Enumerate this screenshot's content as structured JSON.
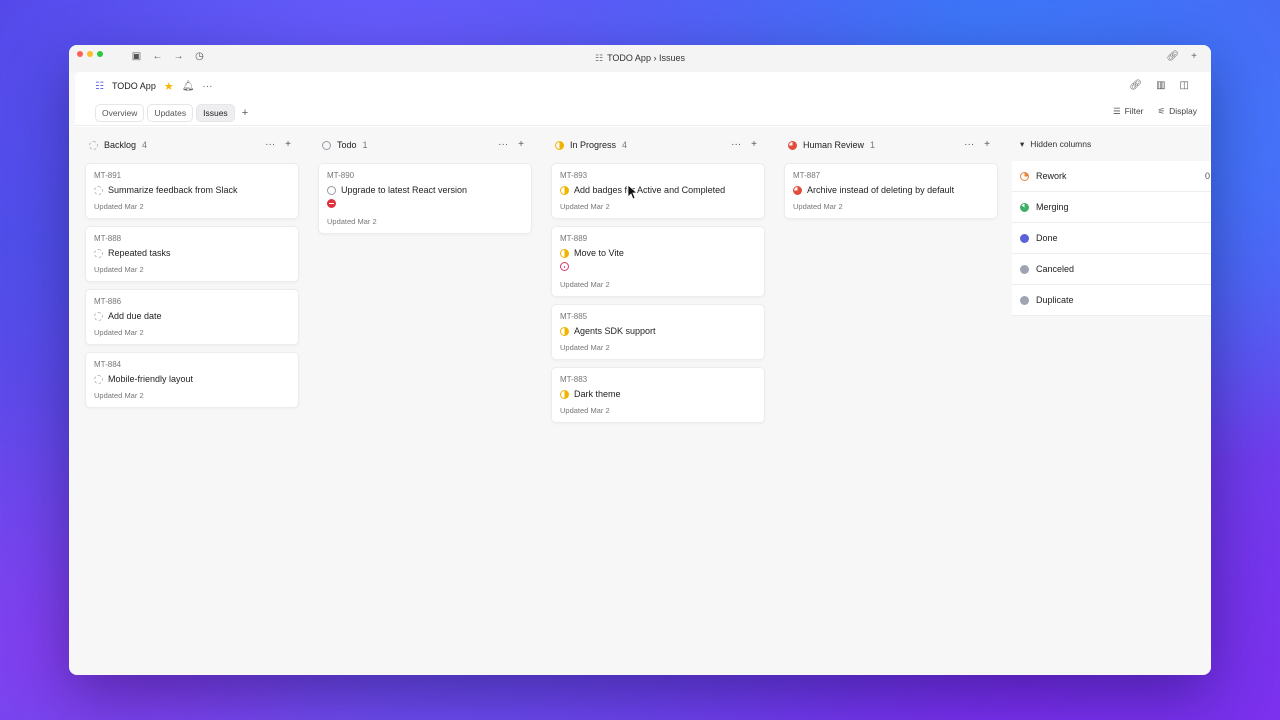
{
  "window": {
    "title": "TODO App › Issues"
  },
  "app": {
    "name": "TODO App"
  },
  "tabs": [
    {
      "label": "Overview"
    },
    {
      "label": "Updates"
    },
    {
      "label": "Issues"
    }
  ],
  "toolbar": {
    "filter_label": "Filter",
    "display_label": "Display"
  },
  "columns": [
    {
      "name": "Backlog",
      "count": "4",
      "cards": [
        {
          "id": "MT-891",
          "title": "Summarize feedback from Slack",
          "updated": "Updated Mar 2"
        },
        {
          "id": "MT-888",
          "title": "Repeated tasks",
          "updated": "Updated Mar 2"
        },
        {
          "id": "MT-886",
          "title": "Add due date",
          "updated": "Updated Mar 2"
        },
        {
          "id": "MT-884",
          "title": "Mobile-friendly layout",
          "updated": "Updated Mar 2"
        }
      ]
    },
    {
      "name": "Todo",
      "count": "1",
      "cards": [
        {
          "id": "MT-890",
          "title": "Upgrade to latest React version",
          "updated": "Updated Mar 2"
        }
      ]
    },
    {
      "name": "In Progress",
      "count": "4",
      "cards": [
        {
          "id": "MT-893",
          "title": "Add badges for Active and Completed",
          "updated": "Updated Mar 2"
        },
        {
          "id": "MT-889",
          "title": "Move to Vite",
          "updated": "Updated Mar 2"
        },
        {
          "id": "MT-885",
          "title": "Agents SDK support",
          "updated": "Updated Mar 2"
        },
        {
          "id": "MT-883",
          "title": "Dark theme",
          "updated": "Updated Mar 2"
        }
      ]
    },
    {
      "name": "Human Review",
      "count": "1",
      "cards": [
        {
          "id": "MT-887",
          "title": "Archive instead of deleting by default",
          "updated": "Updated Mar 2"
        }
      ]
    }
  ],
  "hidden_columns": {
    "label": "Hidden columns",
    "items": [
      {
        "name": "Rework",
        "count": "0"
      },
      {
        "name": "Merging"
      },
      {
        "name": "Done"
      },
      {
        "name": "Canceled"
      },
      {
        "name": "Duplicate"
      }
    ]
  }
}
